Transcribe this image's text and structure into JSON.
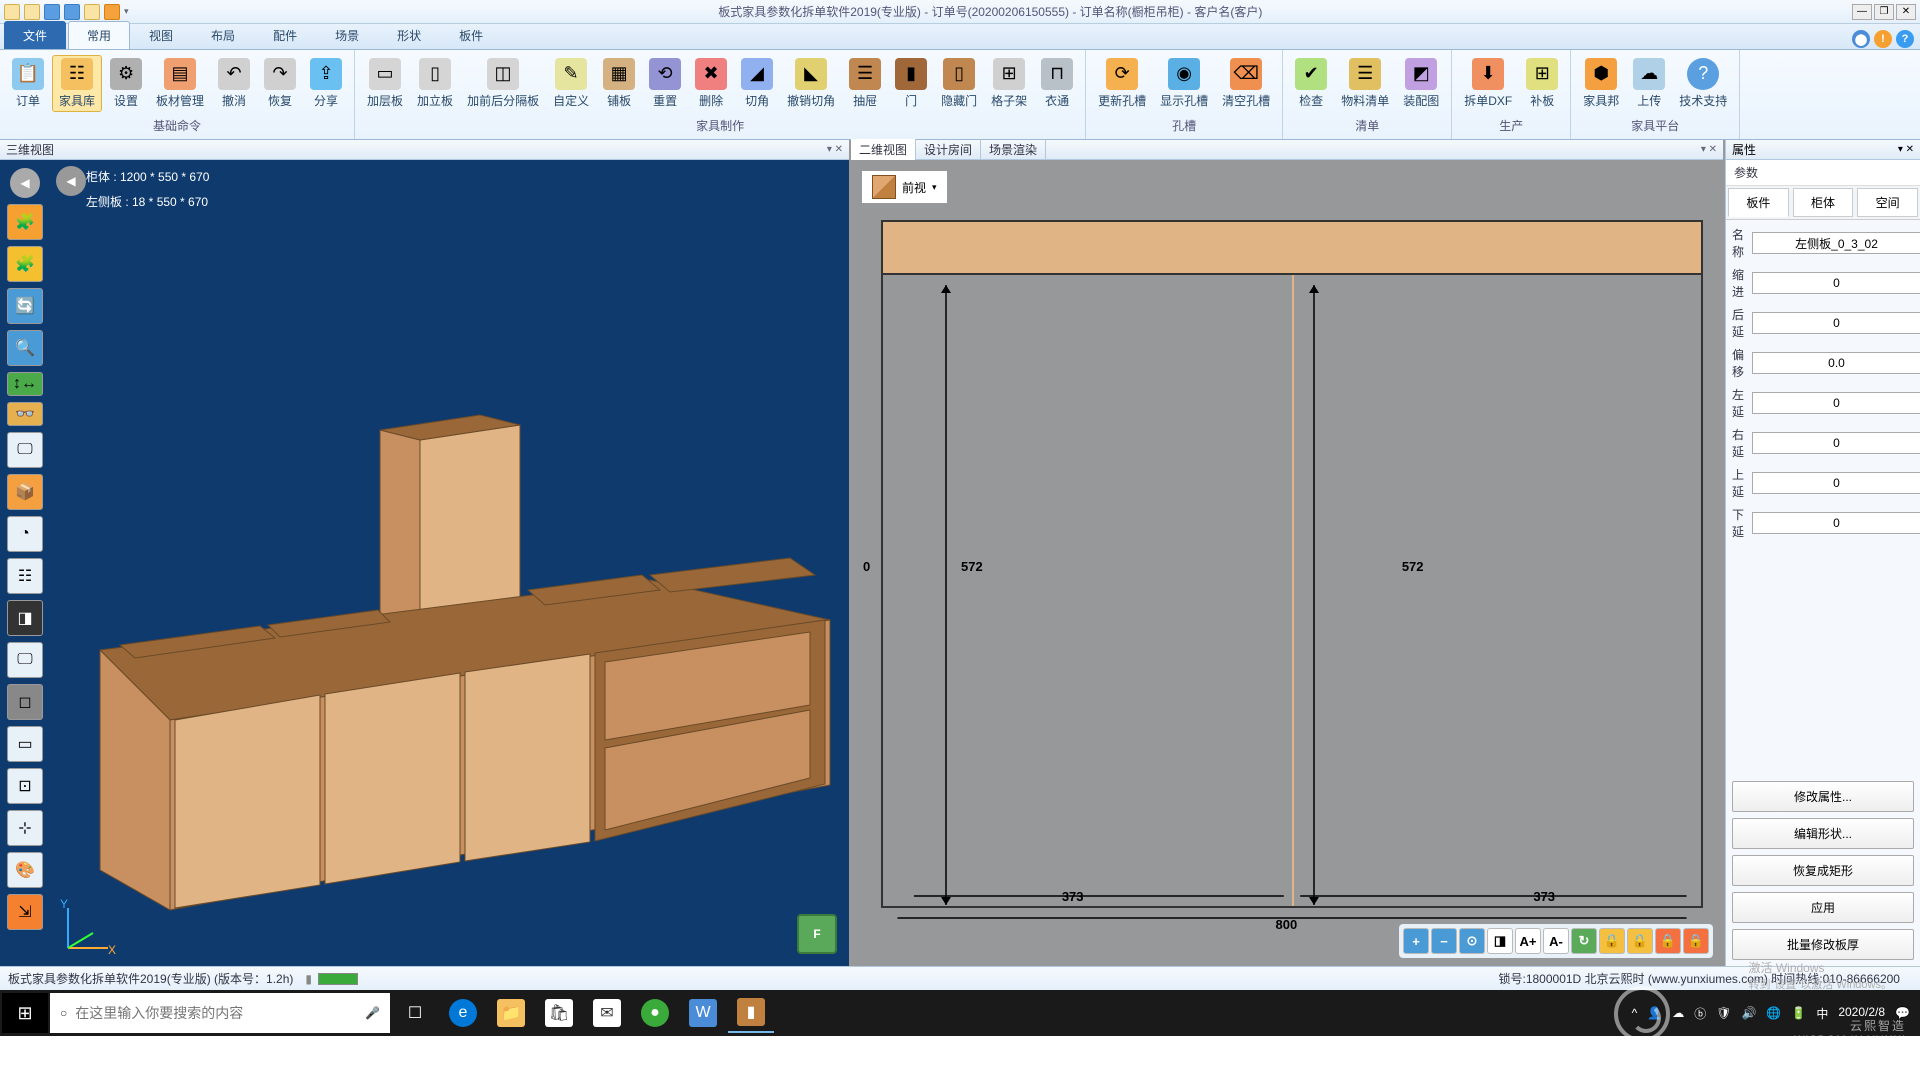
{
  "title": "板式家具参数化拆单软件2019(专业版) - 订单号(20200206150555) - 订单名称(橱柜吊柜) - 客户名(客户)",
  "ribbon_tabs": {
    "file": "文件",
    "t0": "常用",
    "t1": "视图",
    "t2": "布局",
    "t3": "配件",
    "t4": "场景",
    "t5": "形状",
    "t6": "板件"
  },
  "groups": {
    "basic": {
      "label": "基础命令",
      "b0": "订单",
      "b1": "家具库",
      "b2": "设置",
      "b3": "板材管理",
      "b4": "撤消",
      "b5": "恢复",
      "b6": "分享"
    },
    "make": {
      "label": "家具制作",
      "b0": "加层板",
      "b1": "加立板",
      "b2": "加前后分隔板",
      "b3": "自定义",
      "b4": "铺板",
      "b5": "重置",
      "b6": "删除",
      "b7": "切角",
      "b8": "撤销切角",
      "b9": "抽屉",
      "b10": "门",
      "b11": "隐藏门",
      "b12": "格子架",
      "b13": "衣通"
    },
    "hole": {
      "label": "孔槽",
      "b0": "更新孔槽",
      "b1": "显示孔槽",
      "b2": "清空孔槽"
    },
    "list": {
      "label": "清单",
      "b0": "检查",
      "b1": "物料清单",
      "b2": "装配图"
    },
    "prod": {
      "label": "生产",
      "b0": "拆单DXF",
      "b1": "补板"
    },
    "plat": {
      "label": "家具平台",
      "b0": "家具邦",
      "b1": "上传",
      "b2": "技术支持"
    }
  },
  "view3d": {
    "title": "三维视图",
    "info1": "柜体 : 1200 * 550 * 670",
    "info2": "左侧板 : 18 * 550 * 670",
    "y": "Y",
    "x": "X",
    "f": "F"
  },
  "view2d": {
    "tab0": "二维视图",
    "tab1": "设计房间",
    "tab2": "场景渲染",
    "viewsel": "前视",
    "dim572a": "572",
    "dim572b": "572",
    "dim373a": "373",
    "dim373b": "373",
    "dim800": "800",
    "dim0": "0",
    "tb": {
      "aplus": "A+",
      "aminus": "A-"
    }
  },
  "props": {
    "title": "属性",
    "sub": "参数",
    "tab0": "板件",
    "tab1": "柜体",
    "tab2": "空间",
    "f0": {
      "label": "名称",
      "value": "左侧板_0_3_02"
    },
    "f1": {
      "label": "缩进",
      "value": "0"
    },
    "f2": {
      "label": "后延",
      "value": "0"
    },
    "f3": {
      "label": "偏移",
      "value": "0.0"
    },
    "f4": {
      "label": "左延",
      "value": "0"
    },
    "f5": {
      "label": "右延",
      "value": "0"
    },
    "f6": {
      "label": "上延",
      "value": "0"
    },
    "f7": {
      "label": "下延",
      "value": "0"
    },
    "btn0": "修改属性...",
    "btn1": "编辑形状...",
    "btn2": "恢复成矩形",
    "btn3": "应用",
    "btn4": "批量修改板厚"
  },
  "status": {
    "left": "板式家具参数化拆单软件2019(专业版) (版本号：1.2h)",
    "right": "锁号:1800001D 北京云熙时      (www.yunxiumes.com)  时间热线:010-86666200"
  },
  "watermark": {
    "main": "云熙智造",
    "sub": "WISDOM IN YUNXI"
  },
  "activate": {
    "l1": "激活 Windows",
    "l2": "转到\"设置\"以激活 Windows。"
  },
  "taskbar": {
    "search_placeholder": "在这里输入你要搜索的内容",
    "time": "2020/2/8"
  }
}
